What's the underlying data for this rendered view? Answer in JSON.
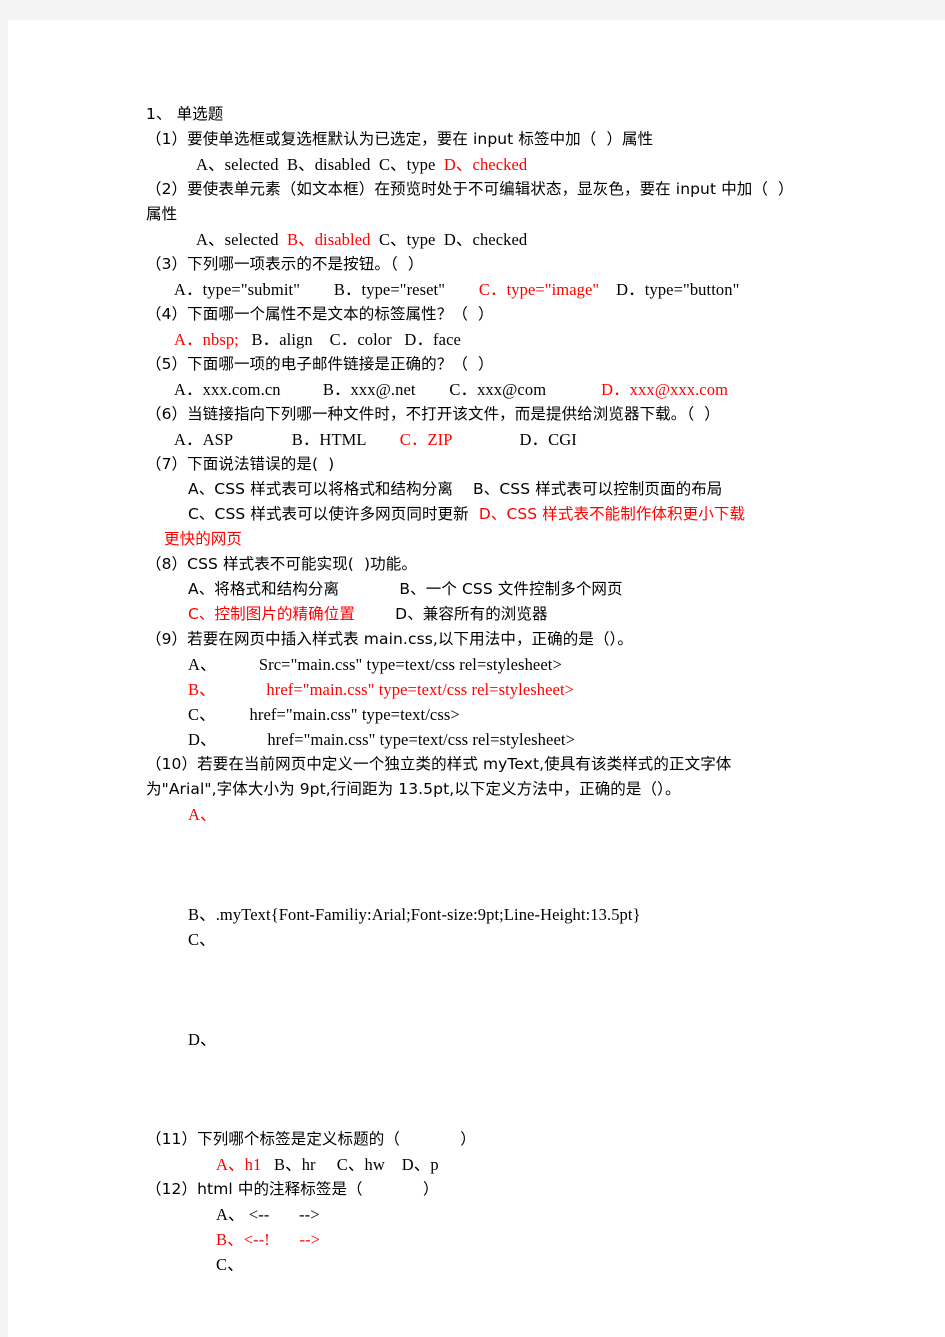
{
  "document": {
    "section_heading": "1、 单选题",
    "accent_color": "#ff0000",
    "text_color": "#000000",
    "page_background": "#ffffff",
    "canvas_background": "#f4f4f4"
  },
  "questions": [
    {
      "number": "（1）",
      "stem": "（1）要使单选框或复选框默认为已选定，要在 input 标签中加（  ）属性",
      "options_line": "A、selected  B、disabled  C、type  ",
      "options_answer": "D、checked",
      "answer": "D"
    },
    {
      "number": "（2）",
      "stem_line1": "（2）要使表单元素（如文本框）在预览时处于不可编辑状态，显灰色，要在 input 中加（  ）",
      "stem_line2": "属性",
      "opt_a": "A、selected  ",
      "opt_b": "B、disabled",
      "opt_cd": "  C、type  D、checked",
      "answer": "B"
    },
    {
      "number": "（3）",
      "stem": "（3）下列哪一项表示的不是按钮。（  ）",
      "opt_ab": "A．type=\"submit\"        B．type=\"reset\"        ",
      "opt_c": "C．type=\"image\"",
      "opt_d": "    D．type=\"button\"",
      "answer": "C"
    },
    {
      "number": "（4）",
      "stem": "（4）下面哪一个属性不是文本的标签属性？（  ）",
      "opt_a": "A．nbsp;",
      "opt_bcd": "   B．align    C．color   D．face",
      "answer": "A"
    },
    {
      "number": "（5）",
      "stem": "（5）下面哪一项的电子邮件链接是正确的？（  ）",
      "opt_abc": "A．xxx.com.cn          B．xxx@.net        C．xxx@com             ",
      "opt_d": "D．xxx@xxx.com",
      "answer": "D"
    },
    {
      "number": "（6）",
      "stem": "（6）当链接指向下列哪一种文件时，不打开该文件，而是提供给浏览器下载。（  ）",
      "opt_ab": "A．ASP              B．HTML        ",
      "opt_c": "C．ZIP",
      "opt_d": "                D．CGI",
      "answer": "C"
    },
    {
      "number": "（7）",
      "stem": "（7）下面说法错误的是(  )",
      "opt_ab": "A、CSS 样式表可以将格式和结构分离    B、CSS 样式表可以控制页面的布局",
      "opt_c": "C、CSS 样式表可以使许多网页同时更新  ",
      "opt_d": "D、CSS 样式表不能制作体积更小下载",
      "opt_d_cont": "更快的网页",
      "answer": "D"
    },
    {
      "number": "（8）",
      "stem": "（8）CSS 样式表不可能实现(  )功能。",
      "opt_ab": "A、将格式和结构分离            B、一个 CSS 文件控制多个网页",
      "opt_c": "C、控制图片的精确位置",
      "opt_d": "        D、兼容所有的浏览器",
      "answer": "C"
    },
    {
      "number": "（9）",
      "stem": "（9）若要在网页中插入样式表 main.css,以下用法中，正确的是（）。",
      "opt_a": "A、          Src=\"main.css\" type=text/css rel=stylesheet>",
      "opt_b": "B、            href=\"main.css\" type=text/css rel=stylesheet>",
      "opt_c": "C、        href=\"main.css\" type=text/css>",
      "opt_d": "D、            href=\"main.css\" type=text/css rel=stylesheet>",
      "answer": "B"
    },
    {
      "number": "（10）",
      "stem_line1": "（10）若要在当前网页中定义一个独立类的样式 myText,使具有该类样式的正文字体",
      "stem_line2": "为\"Arial\",字体大小为 9pt,行间距为 13.5pt,以下定义方法中，正确的是（）。",
      "opt_a": "A、",
      "opt_b": "B、.myText{Font-Familiy:Arial;Font-size:9pt;Line-Height:13.5pt}",
      "opt_c": "C、",
      "opt_d": "D、",
      "answer": "A"
    },
    {
      "number": "（11）",
      "stem": "（11）下列哪个标签是定义标题的（            ）",
      "opt_a": "A、h1",
      "opt_bcd": "   B、hr     C、hw    D、p",
      "answer": "A"
    },
    {
      "number": "（12）",
      "stem": "（12）html 中的注释标签是（            ）",
      "opt_a": "A、 <--       -->",
      "opt_b": "B、<--!       -->",
      "opt_c": "C、",
      "answer": "B"
    }
  ]
}
